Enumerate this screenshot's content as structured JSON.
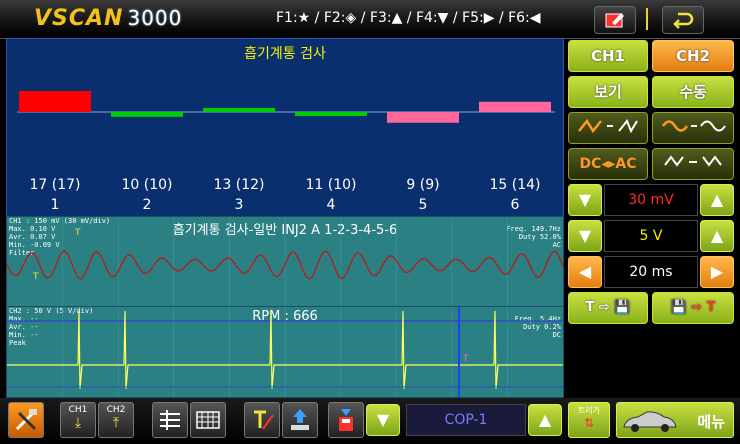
{
  "header": {
    "logo_brand": "VSCAN",
    "logo_model": "3000",
    "function_keys": "F1:★ / F2:◈ / F3:▲ / F4:▼ / F5:▶ / F6:◀"
  },
  "bar_panel": {
    "title": "흡기계통 검사",
    "bars": [
      {
        "value": "17 (17)",
        "cyl": "1",
        "level": 0.35,
        "color": "#ff0000"
      },
      {
        "value": "10 (10)",
        "cyl": "2",
        "level": -0.08,
        "color": "#00cc00"
      },
      {
        "value": "13 (12)",
        "cyl": "3",
        "level": 0.05,
        "color": "#00cc00"
      },
      {
        "value": "11 (10)",
        "cyl": "4",
        "level": -0.04,
        "color": "#00cc00"
      },
      {
        "value": "9 (9)",
        "cyl": "5",
        "level": -0.18,
        "color": "#ff6699"
      },
      {
        "value": "15 (14)",
        "cyl": "6",
        "level": 0.17,
        "color": "#ff6699"
      }
    ]
  },
  "scope1": {
    "title": "흡기계통 검사-일반 INJ2 A 1-2-3-4-5-6",
    "info_left": [
      "CH1 : 150 mV (30 mV/div)",
      "Max.  0.10 V",
      "Avr.  0.07 V",
      "Min. -0.09 V",
      "Filter"
    ],
    "info_right": [
      "Freq. 149.7Hz",
      "Duty 52.0%",
      "AC"
    ]
  },
  "scope2": {
    "title": "RPM : 666",
    "info_left": [
      "CH2 : 50 V (5 V/div)",
      "Max. --",
      "Avr. --",
      "Min. --",
      "Peak"
    ],
    "info_right": [
      "Freq.  5.4Hz",
      "Duty 0.2%",
      "DC"
    ]
  },
  "side": {
    "ch1": "CH1",
    "ch2": "CH2",
    "view": "보기",
    "manual": "수동",
    "dcac": "DC◂▸AC",
    "ch1_scale": "30 mV",
    "ch2_scale": "5 V",
    "time_scale": "20 ms",
    "t_save": "T ⇨ 💾",
    "save_t": "💾 ⇨ T"
  },
  "footer": {
    "ch1_label": "CH1",
    "ch2_label": "CH2",
    "mode_value": "COP-1",
    "trigger_label": "트리거",
    "menu_label": "메뉴"
  },
  "colors": {
    "accent_green": "#a8cc2a",
    "accent_orange": "#f39a2b",
    "scope_bg": "#2b8083",
    "ch1_trace": "#b02020",
    "ch2_trace": "#ffff60"
  }
}
